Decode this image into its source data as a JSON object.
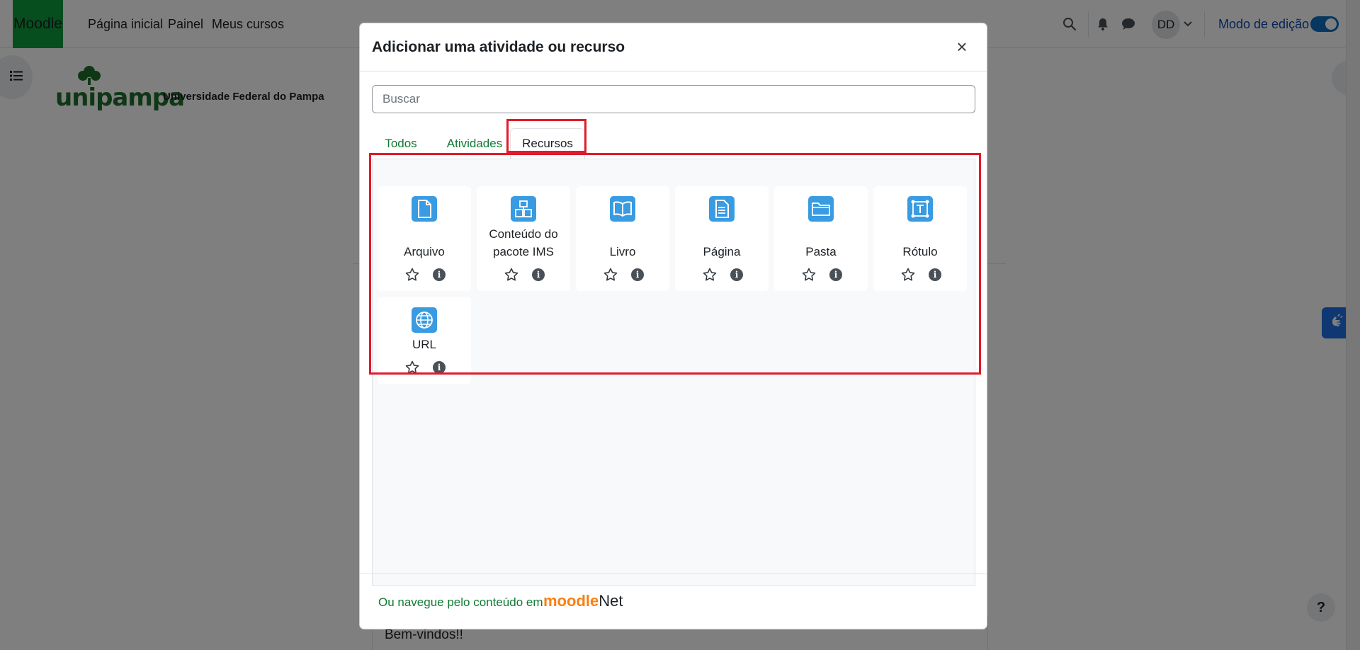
{
  "navbar": {
    "brand": "Moodle",
    "links": [
      "Página inicial",
      "Painel",
      "Meus cursos"
    ],
    "avatar": "DD",
    "edit_mode_label": "Modo de edição"
  },
  "logo": {
    "word": "unipampa",
    "subtitle": "Universidade Federal do Pampa"
  },
  "page": {
    "welcome": "Bem-vindos!!"
  },
  "help": {
    "label": "?"
  },
  "modal": {
    "title": "Adicionar uma atividade ou recurso",
    "close": "×",
    "search_placeholder": "Buscar",
    "tabs": [
      "Todos",
      "Atividades",
      "Recursos"
    ],
    "active_tab": "Recursos",
    "items": [
      {
        "name": "Arquivo",
        "icon": "file-icon"
      },
      {
        "name": "Conteúdo do pacote IMS",
        "icon": "ims-package-icon"
      },
      {
        "name": "Livro",
        "icon": "book-icon"
      },
      {
        "name": "Página",
        "icon": "page-icon"
      },
      {
        "name": "Pasta",
        "icon": "folder-icon"
      },
      {
        "name": "Rótulo",
        "icon": "label-icon"
      },
      {
        "name": "URL",
        "icon": "globe-icon"
      }
    ],
    "info_glyph": "i",
    "footer_text": "Ou navegue pelo conteúdo em",
    "footer_logo_prefix": "moodle",
    "footer_logo_suffix": "Net"
  },
  "colors": {
    "accent_green": "#0f7a33",
    "icon_blue": "#399be2",
    "highlight_red": "#e01b2b",
    "brand_green": "#0d9c3a"
  }
}
